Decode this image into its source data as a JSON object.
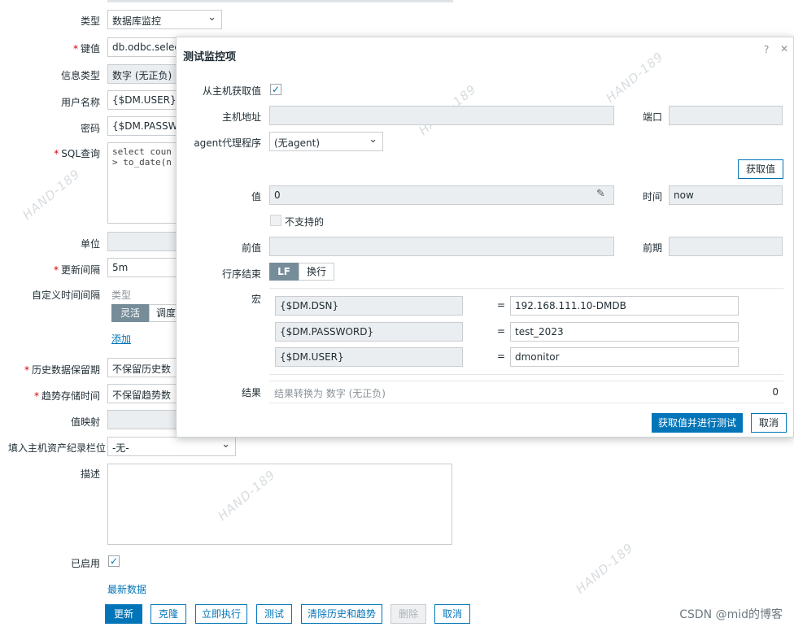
{
  "form": {
    "type_label": "类型",
    "type_value": "数据库监控",
    "key_label": "键值",
    "key_value": "db.odbc.select[",
    "info_type_label": "信息类型",
    "info_type_value": "数字 (无正负)",
    "username_label": "用户名称",
    "username_value": "{$DM.USER}",
    "password_label": "密码",
    "password_value": "{$DM.PASSWO",
    "sql_label": "SQL查询",
    "sql_value": "select coun\n> to_date(n",
    "units_label": "单位",
    "interval_label": "更新间隔",
    "interval_value": "5m",
    "custom_intervals_label": "自定义时间间隔",
    "custom_type_header": "类型",
    "custom_flexible": "灵活",
    "custom_scheduling": "调度",
    "custom_add": "添加",
    "history_label": "历史数据保留期",
    "history_value": "不保留历史数",
    "trends_label": "趋势存储时间",
    "trends_value": "不保留趋势数",
    "valuemap_label": "值映射",
    "inventory_label": "填入主机资产纪录栏位",
    "inventory_value": "-无-",
    "description_label": "描述",
    "enabled_label": "已启用",
    "latest_data_link": "最新数据",
    "buttons": {
      "update": "更新",
      "clone": "克隆",
      "execute_now": "立即执行",
      "test": "测试",
      "clear_history": "清除历史和趋势",
      "delete": "删除",
      "cancel": "取消"
    }
  },
  "modal": {
    "title": "测试监控项",
    "help": "?",
    "close": "✕",
    "get_from_host_label": "从主机获取值",
    "host_address_label": "主机地址",
    "port_label": "端口",
    "agent_proxy_label": "agent代理程序",
    "agent_proxy_value": "(无agent)",
    "get_value_button": "获取值",
    "value_label": "值",
    "value": "0",
    "time_label": "时间",
    "time_value": "now",
    "not_supported_label": "不支持的",
    "prev_value_label": "前值",
    "prev_time_label": "前期",
    "eol_label": "行序结束",
    "eol_lf": "LF",
    "eol_crlf": "换行",
    "macros_label": "宏",
    "macros": [
      {
        "name": "{$DM.DSN}",
        "value": "192.168.111.10-DMDB"
      },
      {
        "name": "{$DM.PASSWORD}",
        "value": "test_2023"
      },
      {
        "name": "{$DM.USER}",
        "value": "dmonitor"
      }
    ],
    "result_label": "结果",
    "result_text": "结果转换为 数字 (无正负)",
    "result_value": "0",
    "test_button": "获取值并进行测试",
    "cancel_button": "取消"
  },
  "watermark_text": "HAND-189",
  "footer_credit": "CSDN @mid的博客",
  "colors": {
    "accent": "#0275b8",
    "required": "#d40000"
  }
}
